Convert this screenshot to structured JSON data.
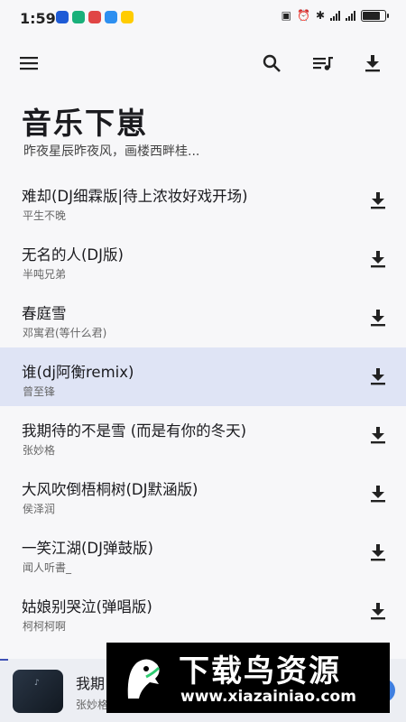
{
  "status_bar": {
    "time": "1:59",
    "app_icons": [
      {
        "name": "music-app-icon",
        "color": "#1e5bd6"
      },
      {
        "name": "download-app-icon",
        "color": "#19b07a"
      },
      {
        "name": "weibo-app-icon",
        "color": "#e04545"
      },
      {
        "name": "cloud-app-icon",
        "color": "#2d8ff0"
      },
      {
        "name": "meituan-app-icon",
        "color": "#ffcc00"
      }
    ],
    "battery_level": 0.85
  },
  "toolbar": {
    "icons": [
      "menu-icon",
      "search-icon",
      "playlist-icon",
      "download-all-icon"
    ]
  },
  "header": {
    "title": "音乐下崽",
    "subtitle": "昨夜星辰昨夜风，画楼西畔桂..."
  },
  "songs": [
    {
      "title": "难却(DJ细霖版|待上浓妆好戏开场)",
      "artist": "平生不晚"
    },
    {
      "title": "无名的人(DJ版)",
      "artist": "半吨兄弟"
    },
    {
      "title": "春庭雪",
      "artist": "邓寓君(等什么君)"
    },
    {
      "title": "谁(dj阿衡remix)",
      "artist": "曾至锋"
    },
    {
      "title": "我期待的不是雪 (而是有你的冬天)",
      "artist": "张妙格"
    },
    {
      "title": "大风吹倒梧桐树(DJ默涵版)",
      "artist": "侯泽润"
    },
    {
      "title": "一笑江湖(DJ弹鼓版)",
      "artist": "闻人听書_"
    },
    {
      "title": "姑娘别哭泣(弹唱版)",
      "artist": "柯柯柯啊"
    }
  ],
  "active_song_index": 3,
  "player": {
    "title_visible": "我期",
    "artist_visible": "张妙格",
    "progress": 0.02
  },
  "watermark": {
    "title": "下载鸟资源",
    "url": "www.xiazainiao.com"
  },
  "colors": {
    "accent": "#3f51b5",
    "active_row": "#dfe4f5"
  }
}
